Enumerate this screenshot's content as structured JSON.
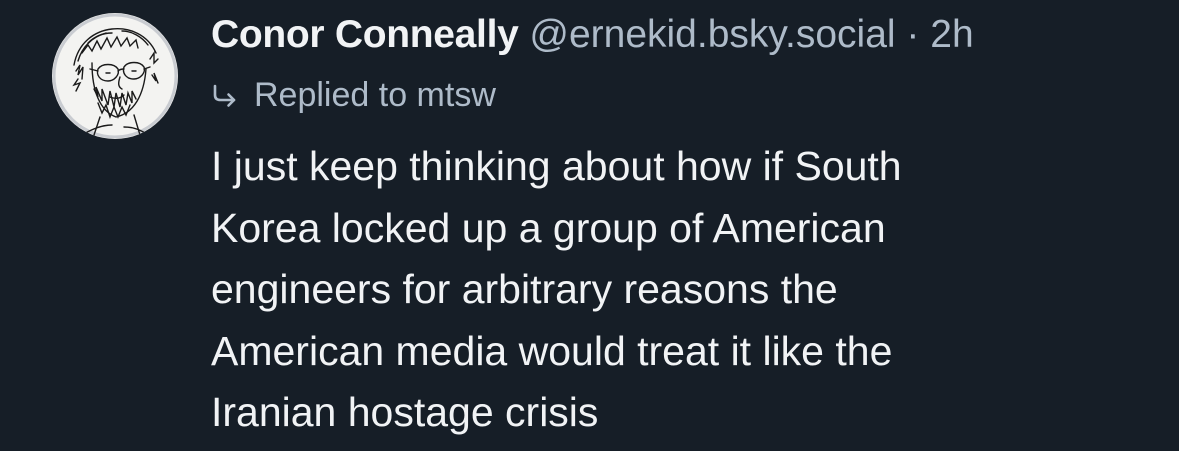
{
  "post": {
    "author": {
      "display_name": "Conor Conneally",
      "handle": "@ernekid.bsky.social"
    },
    "separator": "·",
    "timestamp": "2h",
    "reply": {
      "icon": "reply-arrow-icon",
      "label": "Replied to mtsw"
    },
    "text": "I just keep thinking about how if South\nKorea locked up a group of American\nengineers for arbitrary reasons the\nAmerican media would treat it like the\nIranian hostage crisis"
  },
  "colors": {
    "background": "#161e27",
    "text_primary": "#f1f3f5",
    "text_secondary": "#aebbc9"
  }
}
